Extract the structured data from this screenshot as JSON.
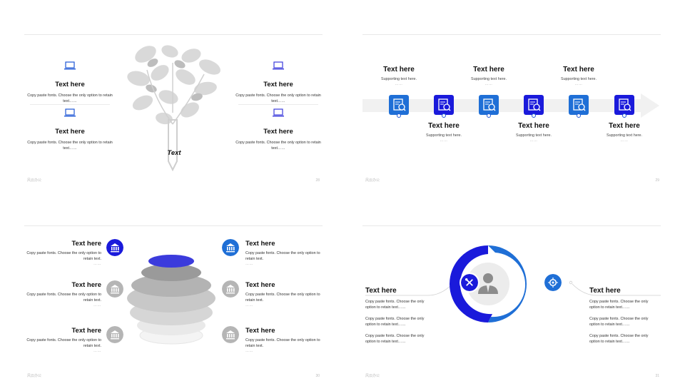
{
  "colors": {
    "accent_blue": "#1f57d6",
    "accent_violet": "#1a1adb",
    "accent_indigo": "#3b3bdc",
    "grey": "#b5b5b5"
  },
  "slide1": {
    "items": [
      {
        "title": "Text here",
        "body": "Copy paste fonts. Choose the only option to retain text……",
        "icon": "laptop-icon"
      },
      {
        "title": "Text here",
        "body": "Copy paste fonts. Choose the only option to retain text……",
        "icon": "laptop-icon"
      },
      {
        "title": "Text here",
        "body": "Copy paste fonts. Choose the only option to retain text……",
        "icon": "laptop-icon"
      },
      {
        "title": "Text here",
        "body": "Copy paste fonts. Choose the only option to retain text……",
        "icon": "laptop-icon"
      }
    ],
    "center_label": "Text",
    "footer_left": "风云办公",
    "page_number": "28"
  },
  "slide2": {
    "steps": [
      {
        "title": "Text here",
        "support": "Supporting text here.",
        "dots": "……"
      },
      {
        "title": "Text here",
        "support": "Supporting text here.",
        "dots": "……"
      },
      {
        "title": "Text here",
        "support": "Supporting text here.",
        "dots": "……"
      },
      {
        "title": "Text here",
        "support": "Supporting text here.",
        "dots": "……"
      },
      {
        "title": "Text here",
        "support": "Supporting text here.",
        "dots": "……"
      },
      {
        "title": "Text here",
        "support": "Supporting text here.",
        "dots": "……"
      }
    ],
    "icon": "report-search-icon",
    "footer_left": "风云办公",
    "page_number": "29"
  },
  "slide3": {
    "items": [
      {
        "title": "Text here",
        "body": "Copy paste fonts. Choose the only option to retain text.",
        "dots": "……"
      },
      {
        "title": "Text here",
        "body": "Copy paste fonts. Choose the only option to retain text.",
        "dots": "……"
      },
      {
        "title": "Text here",
        "body": "Copy paste fonts. Choose the only option to retain text.",
        "dots": "……"
      },
      {
        "title": "Text here",
        "body": "Copy paste fonts. Choose the only option to retain text.",
        "dots": "……"
      },
      {
        "title": "Text here",
        "body": "Copy paste fonts. Choose the only option to retain text.",
        "dots": "……"
      },
      {
        "title": "Text here",
        "body": "Copy paste fonts. Choose the only option to retain text.",
        "dots": "……"
      }
    ],
    "icon": "bank-icon",
    "footer_left": "风云办公",
    "page_number": "30"
  },
  "slide4": {
    "left": {
      "title": "Text here",
      "lines": [
        "Copy paste fonts. Choose the only option to retain text……",
        "Copy paste fonts. Choose the only option to retain text……",
        "Copy paste fonts. Choose the only option to retain text……"
      ]
    },
    "right": {
      "title": "Text here",
      "lines": [
        "Copy paste fonts. Choose the only option to retain text……",
        "Copy paste fonts. Choose the only option to retain text……",
        "Copy paste fonts. Choose the only option to retain text……"
      ]
    },
    "center_icon": "person-icon",
    "left_badge_icon": "tools-icon",
    "right_badge_icon": "settings-icon",
    "footer_left": "风云办公",
    "page_number": "31"
  }
}
